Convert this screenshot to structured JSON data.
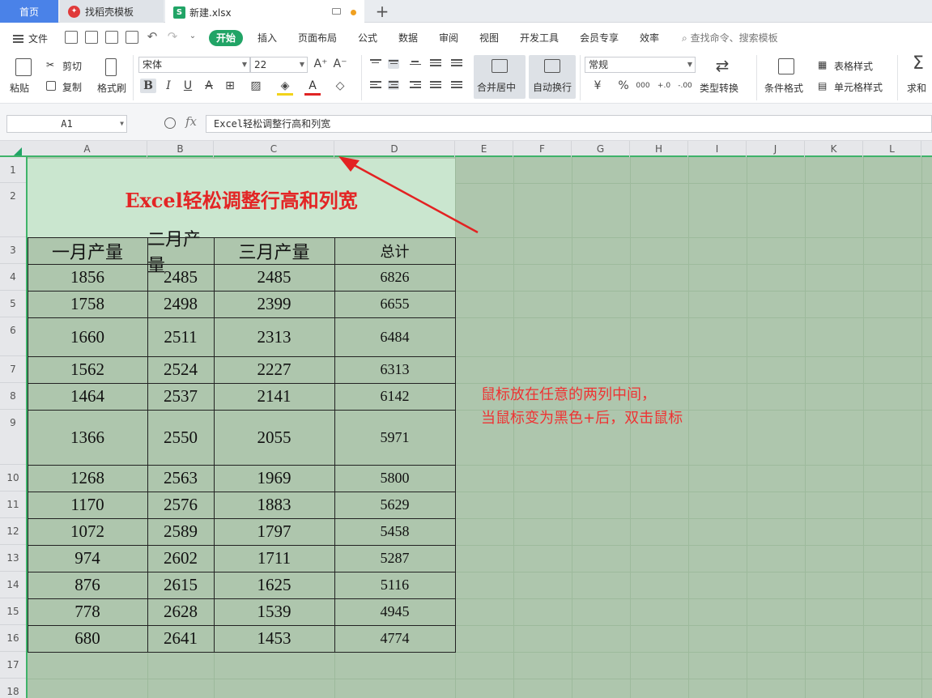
{
  "tabs": {
    "home": "首页",
    "templates": "找稻壳模板",
    "file": "新建.xlsx",
    "xls_badge": "S"
  },
  "menu": {
    "file": "文件",
    "items": [
      "开始",
      "插入",
      "页面布局",
      "公式",
      "数据",
      "审阅",
      "视图",
      "开发工具",
      "会员专享",
      "效率"
    ],
    "active": "开始",
    "search": "查找命令、搜索模板"
  },
  "ribbon": {
    "paste": "粘贴",
    "cut": "剪切",
    "copy": "复制",
    "format_painter": "格式刷",
    "font_name": "宋体",
    "font_size": "22",
    "bold": "B",
    "italic": "I",
    "underline": "U",
    "merge_center": "合并居中",
    "wrap_text": "自动换行",
    "number_format": "常规",
    "currency": "¥",
    "percent": "%",
    "thousands": "000",
    "inc_decimal": "+.0",
    "dec_decimal": "-.00",
    "type_convert": "类型转换",
    "conditional_format": "条件格式",
    "table_style": "表格样式",
    "cell_style": "单元格样式",
    "sum": "求和"
  },
  "formula": {
    "cell_ref": "A1",
    "fx": "fx",
    "content": "Excel轻松调整行高和列宽"
  },
  "sheet": {
    "columns": [
      "A",
      "B",
      "C",
      "D",
      "E",
      "F",
      "G",
      "H",
      "I",
      "J",
      "K",
      "L"
    ],
    "rows": [
      "1",
      "2",
      "3",
      "4",
      "5",
      "6",
      "7",
      "8",
      "9",
      "10",
      "11",
      "12",
      "13",
      "14",
      "15",
      "16",
      "17",
      "18"
    ],
    "title": "Excel轻松调整行高和列宽",
    "headers": [
      "一月产量",
      "二月产量",
      "三月产量",
      "总计"
    ],
    "data": [
      [
        "1856",
        "2485",
        "2485",
        "6826"
      ],
      [
        "1758",
        "2498",
        "2399",
        "6655"
      ],
      [
        "1660",
        "2511",
        "2313",
        "6484"
      ],
      [
        "1562",
        "2524",
        "2227",
        "6313"
      ],
      [
        "1464",
        "2537",
        "2141",
        "6142"
      ],
      [
        "1366",
        "2550",
        "2055",
        "5971"
      ],
      [
        "1268",
        "2563",
        "1969",
        "5800"
      ],
      [
        "1170",
        "2576",
        "1883",
        "5629"
      ],
      [
        "1072",
        "2589",
        "1797",
        "5458"
      ],
      [
        "974",
        "2602",
        "1711",
        "5287"
      ],
      [
        "876",
        "2615",
        "1625",
        "5116"
      ],
      [
        "778",
        "2628",
        "1539",
        "4945"
      ],
      [
        "680",
        "2641",
        "1453",
        "4774"
      ]
    ]
  },
  "annotation": {
    "line1": "鼠标放在任意的两列中间，",
    "line2": "当鼠标变为黑色+后，双击鼠标"
  },
  "colors": {
    "accent": "#21a466",
    "home_tab": "#4a82e8",
    "sheet_bg": "#aec6ad",
    "title_bg": "#cae6cf",
    "annotation": "#e33333"
  }
}
